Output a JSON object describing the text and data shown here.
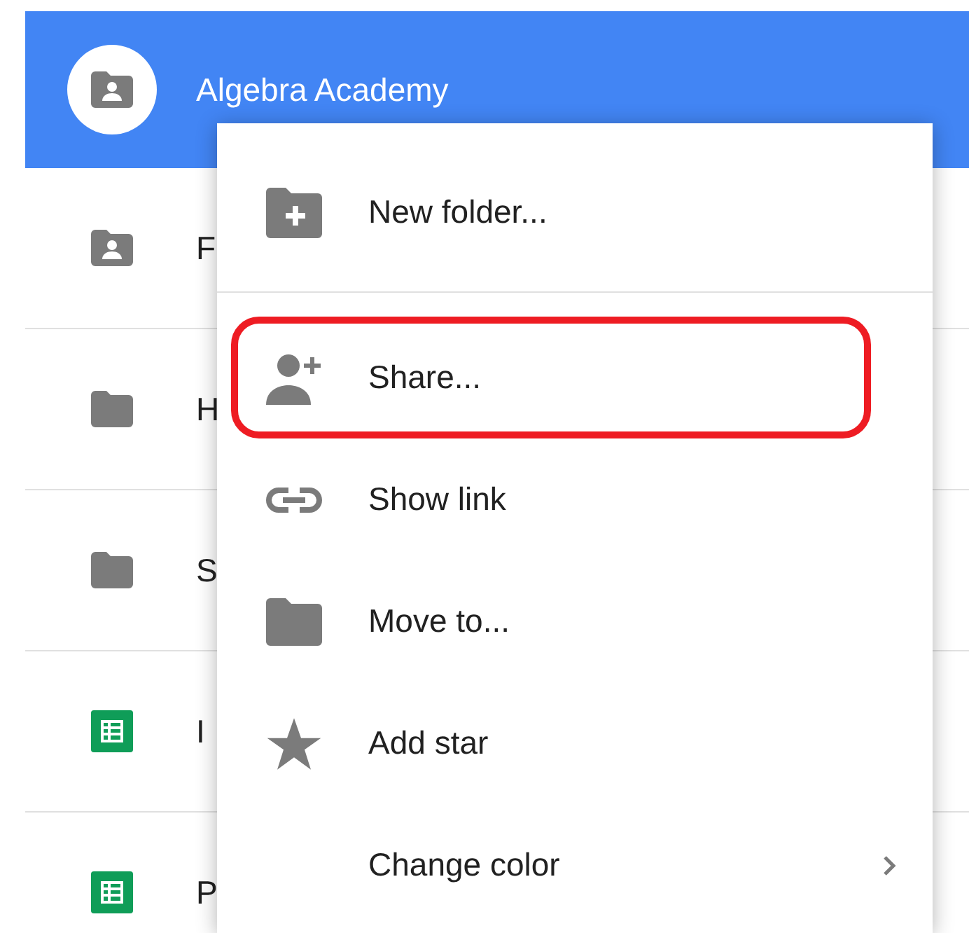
{
  "files": [
    {
      "name": "Algebra Academy",
      "kind": "shared-folder",
      "selected": true
    },
    {
      "name": "F",
      "kind": "shared-folder",
      "selected": false
    },
    {
      "name": "H",
      "kind": "folder",
      "selected": false
    },
    {
      "name": "S",
      "kind": "folder",
      "selected": false
    },
    {
      "name": "I",
      "kind": "sheet",
      "selected": false
    },
    {
      "name": "P",
      "kind": "sheet",
      "selected": false
    }
  ],
  "context_menu": [
    {
      "label": "New folder...",
      "kind": "new-folder",
      "highlighted": false,
      "divider_after": true,
      "submenu": false
    },
    {
      "label": "Share...",
      "kind": "share",
      "highlighted": true,
      "divider_after": false,
      "submenu": false
    },
    {
      "label": "Show link",
      "kind": "link",
      "highlighted": false,
      "divider_after": false,
      "submenu": false
    },
    {
      "label": "Move to...",
      "kind": "move",
      "highlighted": false,
      "divider_after": false,
      "submenu": false
    },
    {
      "label": "Add star",
      "kind": "star",
      "highlighted": false,
      "divider_after": false,
      "submenu": false
    },
    {
      "label": "Change color",
      "kind": "color",
      "highlighted": false,
      "divider_after": false,
      "submenu": true
    }
  ]
}
